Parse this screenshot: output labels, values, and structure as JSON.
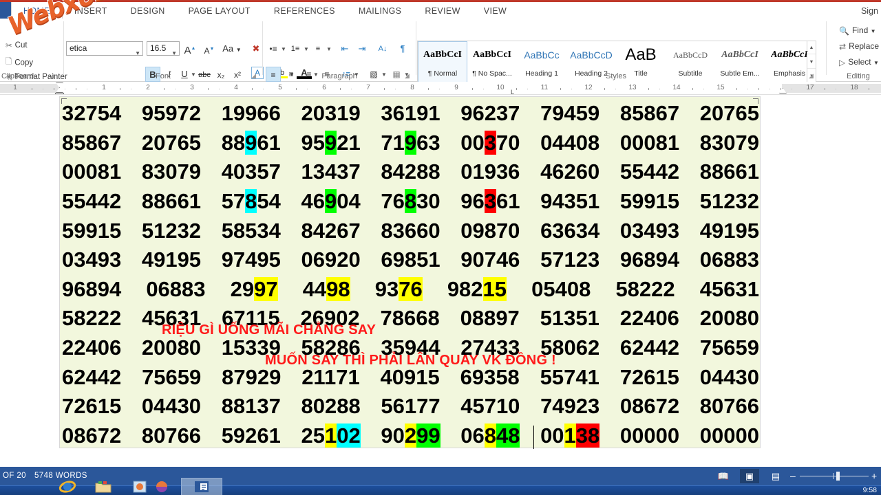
{
  "window": {
    "signin_label": "Sign",
    "watermark": "Webxoso.net"
  },
  "ribbon_tabs": [
    {
      "label": "HOME",
      "active": true
    },
    {
      "label": "INSERT",
      "active": false
    },
    {
      "label": "DESIGN",
      "active": false
    },
    {
      "label": "PAGE LAYOUT",
      "active": false
    },
    {
      "label": "REFERENCES",
      "active": false
    },
    {
      "label": "MAILINGS",
      "active": false
    },
    {
      "label": "REVIEW",
      "active": false
    },
    {
      "label": "VIEW",
      "active": false
    }
  ],
  "clipboard": {
    "group_label": "Clipboard",
    "cut_label": "Cut",
    "copy_label": "Copy",
    "format_painter_label": "Format Painter"
  },
  "font": {
    "group_label": "Font",
    "font_name": "etica",
    "font_size": "16.5",
    "grow_label": "A",
    "shrink_label": "A",
    "change_case_label": "Aa",
    "clear_format_label": "A",
    "bold_label": "B",
    "italic_label": "I",
    "underline_label": "U",
    "strike_label": "abc",
    "subscript_label": "x₂",
    "superscript_label": "x²",
    "text_effects_label": "A",
    "highlight_label": "ab",
    "font_color_label": "A"
  },
  "paragraph": {
    "group_label": "Paragraph",
    "bullets_label": "•≡",
    "numbering_label": "1≡",
    "multilevel_label": "≡",
    "decrease_indent_label": "⇤",
    "increase_indent_label": "⇥",
    "sort_label": "A↓",
    "show_marks_label": "¶",
    "align_left_label": "≡",
    "align_center_label": "≡",
    "align_right_label": "≡",
    "justify_label": "≡",
    "line_spacing_label": "↕≡",
    "shading_label": "▧",
    "borders_label": "▦"
  },
  "styles": {
    "group_label": "Styles",
    "items": [
      {
        "preview": "AaBbCcI",
        "name": "¶ Normal",
        "selected": true
      },
      {
        "preview": "AaBbCcI",
        "name": "¶ No Spac...",
        "selected": false
      },
      {
        "preview": "AaBbCc",
        "name": "Heading 1",
        "selected": false
      },
      {
        "preview": "AaBbCcD",
        "name": "Heading 2",
        "selected": false
      },
      {
        "preview": "AaB",
        "name": "Title",
        "selected": false
      },
      {
        "preview": "AaBbCcD",
        "name": "Subtitle",
        "selected": false
      },
      {
        "preview": "AaBbCcI",
        "name": "Subtle Em...",
        "selected": false
      },
      {
        "preview": "AaBbCcI",
        "name": "Emphasis",
        "selected": false
      }
    ]
  },
  "editing": {
    "group_label": "Editing",
    "find_label": "Find",
    "replace_label": "Replace",
    "select_label": "Select"
  },
  "ruler": {
    "numbers": [
      1,
      1,
      2,
      3,
      4,
      5,
      6,
      7,
      8,
      9,
      10,
      11,
      12,
      13,
      14,
      15,
      17,
      18
    ]
  },
  "document": {
    "lines": [
      {
        "groups": [
          {
            "text": "32754"
          },
          {
            "text": "95972"
          },
          {
            "text": "19966"
          },
          {
            "text": "20319"
          },
          {
            "text": "36191"
          },
          {
            "text": "96237"
          },
          {
            "text": "79459"
          },
          {
            "text": "85867"
          },
          {
            "text": "20765"
          }
        ]
      },
      {
        "groups": [
          {
            "text": "85867"
          },
          {
            "text": "20765"
          },
          {
            "parts": [
              {
                "t": "88"
              },
              {
                "t": "9",
                "hl": "cy"
              },
              {
                "t": "61"
              }
            ]
          },
          {
            "parts": [
              {
                "t": "95"
              },
              {
                "t": "9",
                "hl": "gr"
              },
              {
                "t": "21"
              }
            ]
          },
          {
            "parts": [
              {
                "t": "71"
              },
              {
                "t": "9",
                "hl": "gr"
              },
              {
                "t": "63"
              }
            ]
          },
          {
            "parts": [
              {
                "t": "00"
              },
              {
                "t": "3",
                "hl": "rd"
              },
              {
                "t": "70"
              }
            ]
          },
          {
            "text": "04408"
          },
          {
            "text": "00081"
          },
          {
            "text": "83079"
          }
        ]
      },
      {
        "groups": [
          {
            "text": "00081"
          },
          {
            "text": "83079"
          },
          {
            "text": "40357"
          },
          {
            "text": "13437"
          },
          {
            "text": "84288"
          },
          {
            "text": "01936"
          },
          {
            "text": "46260"
          },
          {
            "text": "55442"
          },
          {
            "text": "88661"
          }
        ]
      },
      {
        "groups": [
          {
            "text": "55442"
          },
          {
            "text": "88661"
          },
          {
            "parts": [
              {
                "t": "57"
              },
              {
                "t": "8",
                "hl": "cy"
              },
              {
                "t": "54"
              }
            ]
          },
          {
            "parts": [
              {
                "t": "46"
              },
              {
                "t": "9",
                "hl": "gr"
              },
              {
                "t": "04"
              }
            ]
          },
          {
            "parts": [
              {
                "t": "76"
              },
              {
                "t": "8",
                "hl": "gr"
              },
              {
                "t": "30"
              }
            ]
          },
          {
            "parts": [
              {
                "t": "96"
              },
              {
                "t": "3",
                "hl": "rd"
              },
              {
                "t": "61"
              }
            ]
          },
          {
            "text": "94351"
          },
          {
            "text": "59915"
          },
          {
            "text": "51232"
          }
        ]
      },
      {
        "groups": [
          {
            "text": "59915"
          },
          {
            "text": "51232"
          },
          {
            "text": "58534"
          },
          {
            "text": "84267"
          },
          {
            "text": "83660"
          },
          {
            "text": "09870"
          },
          {
            "text": "63634"
          },
          {
            "text": "03493"
          },
          {
            "text": "49195"
          }
        ]
      },
      {
        "groups": [
          {
            "text": "03493"
          },
          {
            "text": "49195"
          },
          {
            "text": "97495"
          },
          {
            "text": "06920"
          },
          {
            "text": "69851"
          },
          {
            "text": "90746"
          },
          {
            "text": "57123"
          },
          {
            "text": "96894"
          },
          {
            "text": "06883"
          }
        ]
      },
      {
        "groups": [
          {
            "text": "96894"
          },
          {
            "text": "06883"
          },
          {
            "parts": [
              {
                "t": "29"
              },
              {
                "t": "97",
                "hl": "ye"
              }
            ]
          },
          {
            "parts": [
              {
                "t": "44"
              },
              {
                "t": "98",
                "hl": "ye"
              }
            ]
          },
          {
            "parts": [
              {
                "t": "93"
              },
              {
                "t": "76",
                "hl": "ye"
              }
            ]
          },
          {
            "parts": [
              {
                "t": "982"
              },
              {
                "t": "15",
                "hl": "ye"
              }
            ]
          },
          {
            "text": "05408"
          },
          {
            "text": "58222"
          },
          {
            "text": "45631"
          }
        ]
      },
      {
        "groups": [
          {
            "text": "58222"
          },
          {
            "text": "45631"
          },
          {
            "text": "67115"
          },
          {
            "text": "26902"
          },
          {
            "text": "78668"
          },
          {
            "text": "08897"
          },
          {
            "text": "51351"
          },
          {
            "text": "22406"
          },
          {
            "text": "20080"
          }
        ]
      },
      {
        "groups": [
          {
            "text": "22406"
          },
          {
            "text": "20080"
          },
          {
            "text": "15339"
          },
          {
            "text": "58286"
          },
          {
            "text": "35944"
          },
          {
            "text": "27433"
          },
          {
            "text": "58062"
          },
          {
            "text": "62442"
          },
          {
            "text": "75659"
          }
        ]
      },
      {
        "groups": [
          {
            "text": "62442"
          },
          {
            "text": "75659"
          },
          {
            "text": "87929"
          },
          {
            "text": "21171"
          },
          {
            "text": "40915"
          },
          {
            "text": "69358"
          },
          {
            "text": "55741"
          },
          {
            "text": "72615"
          },
          {
            "text": "04430"
          }
        ]
      },
      {
        "groups": [
          {
            "text": "72615"
          },
          {
            "text": "04430"
          },
          {
            "text": "88137"
          },
          {
            "text": "80288"
          },
          {
            "text": "56177"
          },
          {
            "text": "45710"
          },
          {
            "text": "74923"
          },
          {
            "text": "08672"
          },
          {
            "text": "80766"
          }
        ]
      },
      {
        "groups": [
          {
            "text": "08672"
          },
          {
            "text": "80766"
          },
          {
            "text": "59261"
          },
          {
            "parts": [
              {
                "t": "25"
              },
              {
                "t": "1",
                "hl": "ye"
              },
              {
                "t": "02",
                "hl": "cy"
              }
            ]
          },
          {
            "parts": [
              {
                "t": "90"
              },
              {
                "t": "2",
                "hl": "ye"
              },
              {
                "t": "99",
                "hl": "gr"
              }
            ]
          },
          {
            "parts": [
              {
                "t": "06"
              },
              {
                "t": "8",
                "hl": "ye"
              },
              {
                "t": "48",
                "hl": "gr"
              }
            ]
          },
          {
            "parts": [
              {
                "t": "00"
              },
              {
                "t": "1",
                "hl": "ye"
              },
              {
                "t": "38",
                "hl": "rd"
              }
            ]
          },
          {
            "text": "00000"
          },
          {
            "text": "00000"
          }
        ]
      }
    ],
    "overlay": [
      {
        "text": "RIỆU GÌ UỐNG MÃI CHẲNG SAY"
      },
      {
        "text": "MUỐN SAY THÌ PHẢI LÂN QUAY VK ĐỒNG !"
      }
    ]
  },
  "status": {
    "page_label": "OF 20",
    "words_label": "5748 WORDS",
    "read_mode_icon": "read-mode-icon",
    "print_layout_icon": "print-layout-icon",
    "web_layout_icon": "web-layout-icon",
    "zoom_out_label": "–",
    "zoom_in_label": "+"
  },
  "taskbar": {
    "clock": "9:58",
    "icons": [
      "internet-explorer-icon",
      "folder-icon",
      "media-player-icon",
      "firefox-icon",
      "word-icon"
    ]
  },
  "colors": {
    "accent": "#2b579a",
    "ribbon_red": "#c0392b",
    "page_bg": "#f2f7dd",
    "highlight_cyan": "#00ffff",
    "highlight_green": "#00ff00",
    "highlight_red": "#ff0000",
    "highlight_yellow": "#ffff00",
    "overlay_text": "#ff1a1a",
    "watermark": "#e8622a"
  }
}
